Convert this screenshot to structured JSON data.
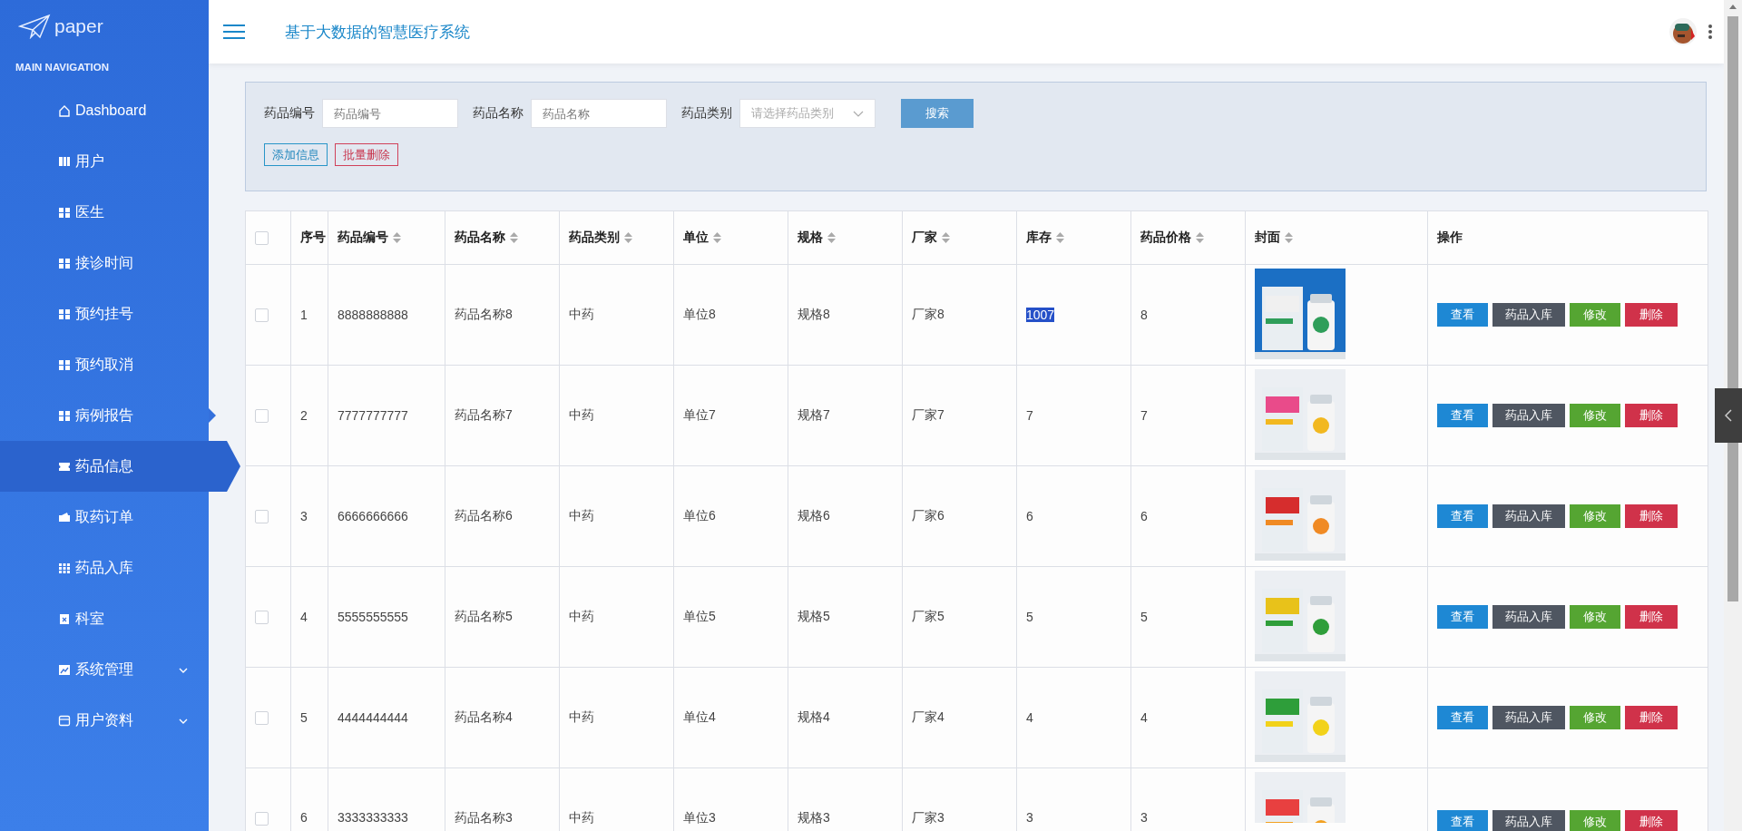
{
  "brand": "paper",
  "nav_heading": "MAIN NAVIGATION",
  "sidebar": {
    "items": [
      {
        "label": "Dashboard",
        "kind": "link",
        "selected": false,
        "hovered": false
      },
      {
        "label": "用户",
        "kind": "link",
        "selected": false,
        "hovered": false
      },
      {
        "label": "医生",
        "kind": "link",
        "selected": false,
        "hovered": false
      },
      {
        "label": "接诊时间",
        "kind": "link",
        "selected": false,
        "hovered": false
      },
      {
        "label": "预约挂号",
        "kind": "link",
        "selected": false,
        "hovered": false
      },
      {
        "label": "预约取消",
        "kind": "link",
        "selected": false,
        "hovered": false
      },
      {
        "label": "病例报告",
        "kind": "link",
        "selected": false,
        "hovered": true
      },
      {
        "label": "药品信息",
        "kind": "link",
        "selected": true,
        "hovered": false
      },
      {
        "label": "取药订单",
        "kind": "link",
        "selected": false,
        "hovered": false
      },
      {
        "label": "药品入库",
        "kind": "link",
        "selected": false,
        "hovered": false
      },
      {
        "label": "科室",
        "kind": "link",
        "selected": false,
        "hovered": false
      },
      {
        "label": "系统管理",
        "kind": "group",
        "expanded": false,
        "selected": false,
        "hovered": false
      },
      {
        "label": "用户资料",
        "kind": "group",
        "expanded": false,
        "selected": false,
        "hovered": false
      }
    ]
  },
  "header": {
    "title": "基于大数据的智慧医疗系统"
  },
  "search": {
    "fields": [
      {
        "label": "药品编号",
        "kind": "text",
        "placeholder": "药品编号"
      },
      {
        "label": "药品名称",
        "kind": "text",
        "placeholder": "药品名称"
      },
      {
        "label": "药品类别",
        "kind": "select",
        "placeholder": "请选择药品类别"
      }
    ],
    "search_button": "搜索",
    "add_button": "添加信息",
    "batch_delete_button": "批量删除"
  },
  "table": {
    "all_checked": false,
    "columns": [
      {
        "label": "序号"
      },
      {
        "label": "药品编号",
        "sortable": true
      },
      {
        "label": "药品名称",
        "sortable": true
      },
      {
        "label": "药品类别",
        "sortable": true
      },
      {
        "label": "单位",
        "sortable": true
      },
      {
        "label": "规格",
        "sortable": true
      },
      {
        "label": "厂家",
        "sortable": true
      },
      {
        "label": "库存",
        "sortable": true
      },
      {
        "label": "药品价格",
        "sortable": true
      },
      {
        "label": "封面",
        "sortable": true
      },
      {
        "label": "操作"
      }
    ],
    "rows": [
      {
        "checked": false,
        "cells": [
          "1",
          "8888888888",
          "药品名称8",
          "中药",
          "单位8",
          "规格8",
          "厂家8",
          "1007",
          "8"
        ],
        "stock_highlighted": true,
        "actions": [
          "查看",
          "药品入库",
          "修改",
          "删除"
        ]
      },
      {
        "checked": false,
        "cells": [
          "2",
          "7777777777",
          "药品名称7",
          "中药",
          "单位7",
          "规格7",
          "厂家7",
          "7",
          "7"
        ],
        "stock_highlighted": false,
        "actions": [
          "查看",
          "药品入库",
          "修改",
          "删除"
        ]
      },
      {
        "checked": false,
        "cells": [
          "3",
          "6666666666",
          "药品名称6",
          "中药",
          "单位6",
          "规格6",
          "厂家6",
          "6",
          "6"
        ],
        "stock_highlighted": false,
        "actions": [
          "查看",
          "药品入库",
          "修改",
          "删除"
        ]
      },
      {
        "checked": false,
        "cells": [
          "4",
          "5555555555",
          "药品名称5",
          "中药",
          "单位5",
          "规格5",
          "厂家5",
          "5",
          "5"
        ],
        "stock_highlighted": false,
        "actions": [
          "查看",
          "药品入库",
          "修改",
          "删除"
        ]
      },
      {
        "checked": false,
        "cells": [
          "5",
          "4444444444",
          "药品名称4",
          "中药",
          "单位4",
          "规格4",
          "厂家4",
          "4",
          "4"
        ],
        "stock_highlighted": false,
        "actions": [
          "查看",
          "药品入库",
          "修改",
          "删除"
        ]
      },
      {
        "checked": false,
        "cells": [
          "6",
          "3333333333",
          "药品名称3",
          "中药",
          "单位3",
          "规格3",
          "厂家3",
          "3",
          "3"
        ],
        "stock_highlighted": false,
        "actions": [
          "查看",
          "药品入库",
          "修改",
          "删除"
        ]
      }
    ]
  }
}
